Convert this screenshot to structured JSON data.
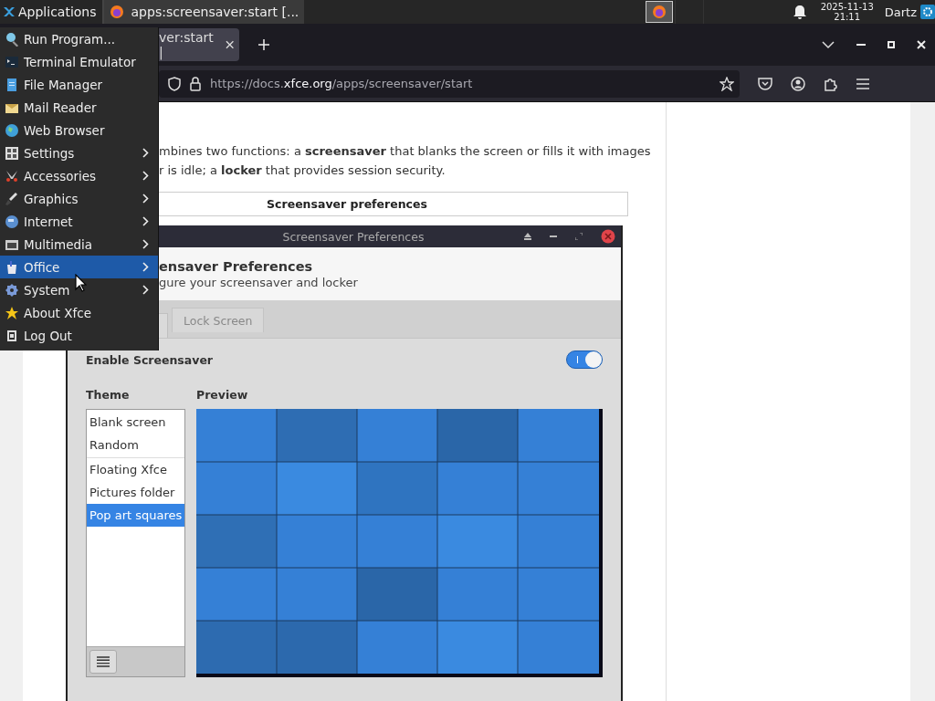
{
  "panel": {
    "applications": "Applications",
    "windows": [
      {
        "title": "apps:screensaver:start [...",
        "selected": true
      }
    ],
    "clock": {
      "date": "2025-11-13",
      "time": "21:11"
    },
    "user": "Dartz"
  },
  "browser": {
    "tabs": [
      {
        "title": "ver:start |"
      }
    ],
    "url": {
      "prefix": "https://docs.",
      "domain": "xfce.org",
      "path": "/apps/screensaver/start"
    }
  },
  "page": {
    "intro_lines": [
      "mbines two functions: a **screensaver** that blanks the screen or fills it with images",
      "r is idle; a **locker** that provides session security."
    ],
    "caption": "Screensaver preferences",
    "dialog": {
      "title": "Screensaver Preferences",
      "heading": "ensaver Preferences",
      "subtitle": "gure your screensaver and locker",
      "tabs": [
        {
          "label": "Lock Screen",
          "selected": false
        }
      ],
      "enable": {
        "label": "Enable Screensaver",
        "on": true
      },
      "theme_label": "Theme",
      "preview_label": "Preview",
      "theme_groups": [
        [
          {
            "name": "Blank screen",
            "selected": false
          },
          {
            "name": "Random",
            "selected": false
          }
        ],
        [
          {
            "name": "Floating Xfce",
            "selected": false
          },
          {
            "name": "Pictures folder",
            "selected": false
          },
          {
            "name": "Pop art squares",
            "selected": true
          }
        ]
      ]
    }
  },
  "app_menu": {
    "items": [
      {
        "label": "Run Program...",
        "submenu": false,
        "selected": false
      },
      {
        "label": "Terminal Emulator",
        "submenu": false,
        "selected": false
      },
      {
        "label": "File Manager",
        "submenu": false,
        "selected": false
      },
      {
        "label": "Mail Reader",
        "submenu": false,
        "selected": false
      },
      {
        "label": "Web Browser",
        "submenu": false,
        "selected": false
      },
      {
        "label": "Settings",
        "submenu": true,
        "selected": false
      },
      {
        "label": "Accessories",
        "submenu": true,
        "selected": false
      },
      {
        "label": "Graphics",
        "submenu": true,
        "selected": false
      },
      {
        "label": "Internet",
        "submenu": true,
        "selected": false
      },
      {
        "label": "Multimedia",
        "submenu": true,
        "selected": false
      },
      {
        "label": "Office",
        "submenu": true,
        "selected": true
      },
      {
        "label": "System",
        "submenu": true,
        "selected": false
      },
      {
        "label": "About Xfce",
        "submenu": false,
        "selected": false
      },
      {
        "label": "Log Out",
        "submenu": false,
        "selected": false
      }
    ]
  }
}
